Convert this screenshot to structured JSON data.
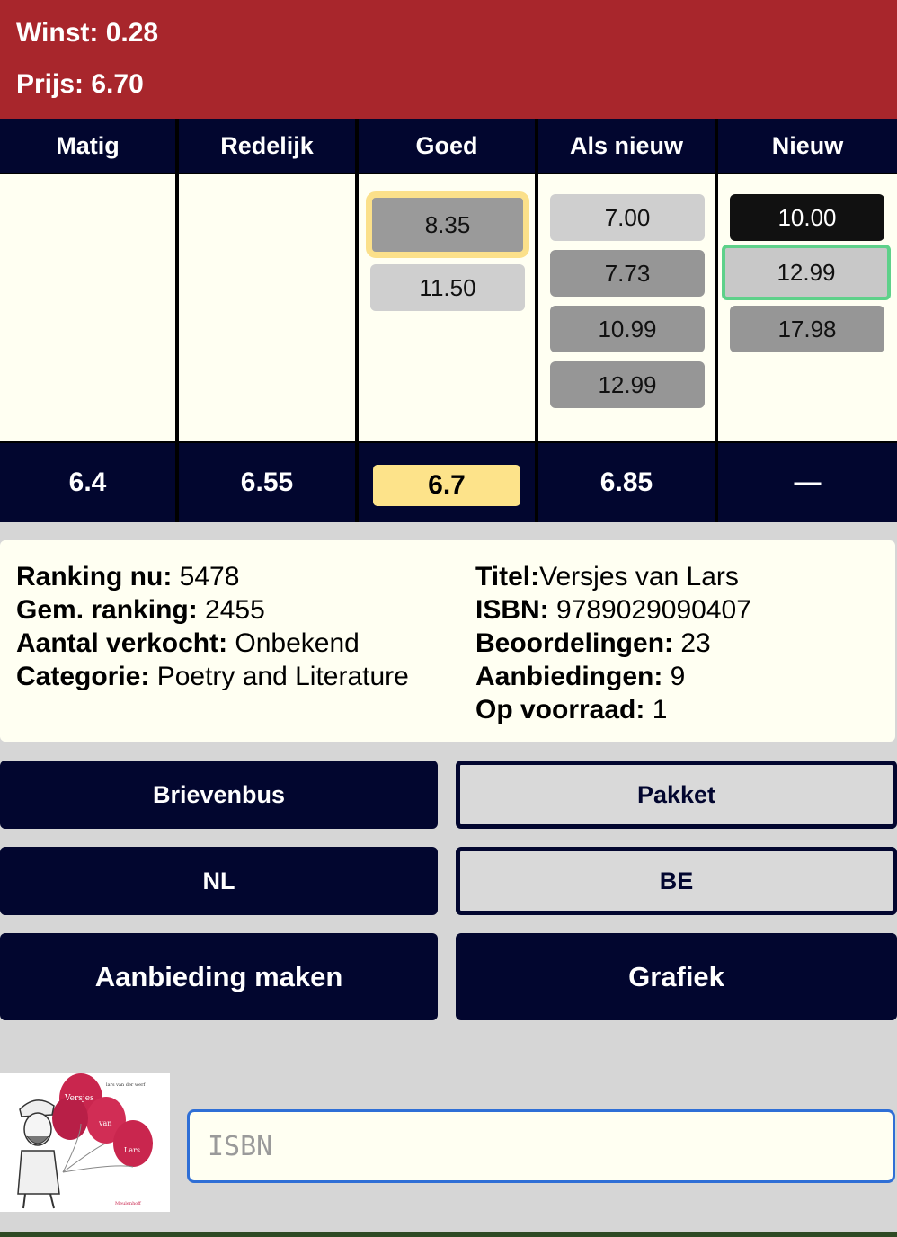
{
  "header": {
    "profit": "Winst: 0.28",
    "price": "Prijs: 6.70"
  },
  "conditions": [
    {
      "name": "Matig",
      "offers": [],
      "footer": "6.4"
    },
    {
      "name": "Redelijk",
      "offers": [],
      "footer": "6.55"
    },
    {
      "name": "Goed",
      "offers": [
        "8.35",
        "11.50"
      ],
      "footer": "6.7"
    },
    {
      "name": "Als nieuw",
      "offers": [
        "7.00",
        "7.73",
        "10.99",
        "12.99"
      ],
      "footer": "6.85"
    },
    {
      "name": "Nieuw",
      "offers": [
        "10.00",
        "12.99",
        "17.98"
      ],
      "footer": "—"
    }
  ],
  "info": {
    "ranking_label": "Ranking nu:",
    "ranking": " 5478",
    "avg_label": "Gem. ranking:",
    "avg": " 2455",
    "sold_label": "Aantal verkocht:",
    "sold": " Onbekend",
    "category_label": "Categorie:",
    "category": " Poetry and Literature",
    "title_label": "Titel:",
    "title": "Versjes van Lars",
    "isbn_label": "ISBN:",
    "isbn": " 9789029090407",
    "reviews_label": "Beoordelingen:",
    "reviews": " 23",
    "offers_label": "Aanbiedingen:",
    "offers": " 9",
    "stock_label": "Op voorraad:",
    "stock": " 1"
  },
  "buttons": {
    "mailbox": "Brievenbus",
    "parcel": "Pakket",
    "nl": "NL",
    "be": "BE",
    "make_offer": "Aanbieding maken",
    "chart": "Grafiek"
  },
  "cover": {
    "author": "lars van der werf",
    "title_words": [
      "Versjes",
      "van",
      "Lars"
    ],
    "publisher": "Meulenhoff"
  },
  "search": {
    "placeholder": "ISBN"
  },
  "colors": {
    "header": "#a8262c",
    "navy": "#02062f",
    "cream": "#fffff2",
    "highlight_yellow": "#fde38a",
    "highlight_green": "#5ed18a"
  }
}
